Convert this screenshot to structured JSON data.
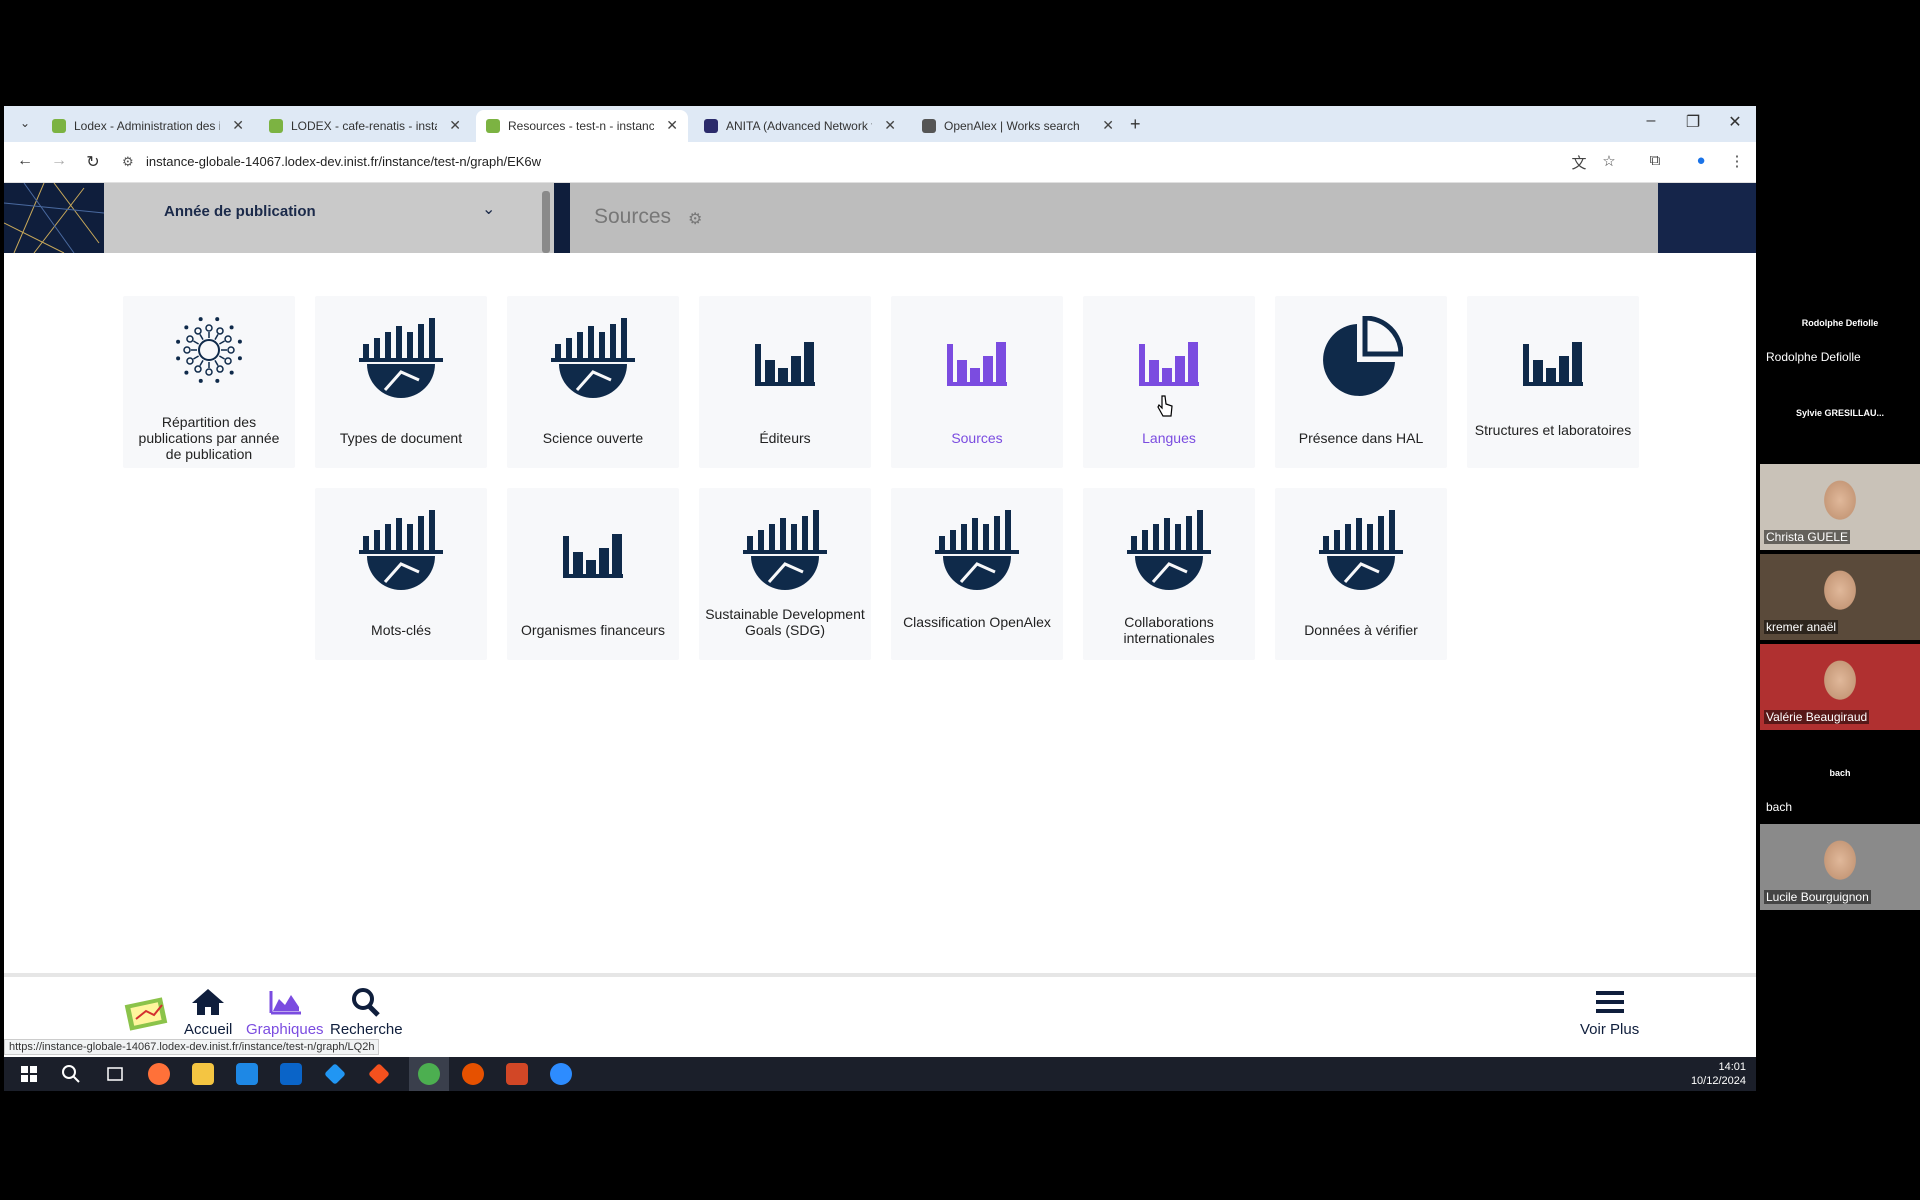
{
  "browser": {
    "tabs": [
      {
        "label": "Lodex - Administration des inst",
        "favicon_color": "#7cb342"
      },
      {
        "label": "LODEX - cafe-renatis - instance",
        "favicon_color": "#7cb342"
      },
      {
        "label": "Resources - test-n - instance-g",
        "favicon_color": "#7cb342"
      },
      {
        "label": "ANITA (Advanced Network for",
        "favicon_color": "#2b2b6b"
      },
      {
        "label": "OpenAlex | Works search",
        "favicon_color": "#555555"
      }
    ],
    "url": "instance-globale-14067.lodex-dev.inist.fr/instance/test-n/graph/EK6w"
  },
  "header": {
    "filter_label": "Année de publication",
    "panel_title": "Sources"
  },
  "graphs_row1": [
    {
      "label": "Répartition des publications par année de publication",
      "icon": "sunburst-icon",
      "highlight": false
    },
    {
      "label": "Types de document",
      "icon": "bar-pie-icon",
      "highlight": false
    },
    {
      "label": "Science ouverte",
      "icon": "bar-pie-icon",
      "highlight": false
    },
    {
      "label": "Éditeurs",
      "icon": "bar-chart-icon",
      "highlight": false
    },
    {
      "label": "Sources",
      "icon": "bar-chart-icon",
      "highlight": true
    },
    {
      "label": "Langues",
      "icon": "bar-chart-icon",
      "highlight": true
    },
    {
      "label": "Présence dans HAL",
      "icon": "pie-chart-icon",
      "highlight": false
    },
    {
      "label": "Structures et laboratoires",
      "icon": "bar-chart-icon",
      "highlight": false
    }
  ],
  "graphs_row2": [
    {
      "label": "Mots-clés",
      "icon": "bar-pie-icon"
    },
    {
      "label": "Organismes financeurs",
      "icon": "bar-chart-icon"
    },
    {
      "label": "Sustainable Development Goals (SDG)",
      "icon": "bar-pie-icon"
    },
    {
      "label": "Classification OpenAlex",
      "icon": "bar-pie-icon"
    },
    {
      "label": "Collaborations internationales",
      "icon": "bar-pie-icon"
    },
    {
      "label": "Données à vérifier",
      "icon": "bar-pie-icon"
    }
  ],
  "bottom_nav": {
    "home": "Accueil",
    "graphs": "Graphiques",
    "search": "Recherche",
    "more": "Voir Plus"
  },
  "status_url": "https://instance-globale-14067.lodex-dev.inist.fr/instance/test-n/graph/LQ2h",
  "taskbar": {
    "time": "14:01",
    "date": "10/12/2024"
  },
  "participants": [
    {
      "name": "Rodolphe Defiolle",
      "title": "Rodolphe Defiolle",
      "video": false
    },
    {
      "name": "",
      "title": "Sylvie GRESILLAU...",
      "video": false
    },
    {
      "name": "Christa GUELE",
      "title": "",
      "video": true
    },
    {
      "name": "kremer anaël",
      "title": "",
      "video": true
    },
    {
      "name": "Valérie Beaugiraud",
      "title": "",
      "video": true
    },
    {
      "name": "bach",
      "title": "bach",
      "video": false
    },
    {
      "name": "Lucile Bourguignon",
      "title": "",
      "video": true
    }
  ],
  "colors": {
    "navy": "#0f2a4a",
    "purple": "#7b4ce0"
  }
}
